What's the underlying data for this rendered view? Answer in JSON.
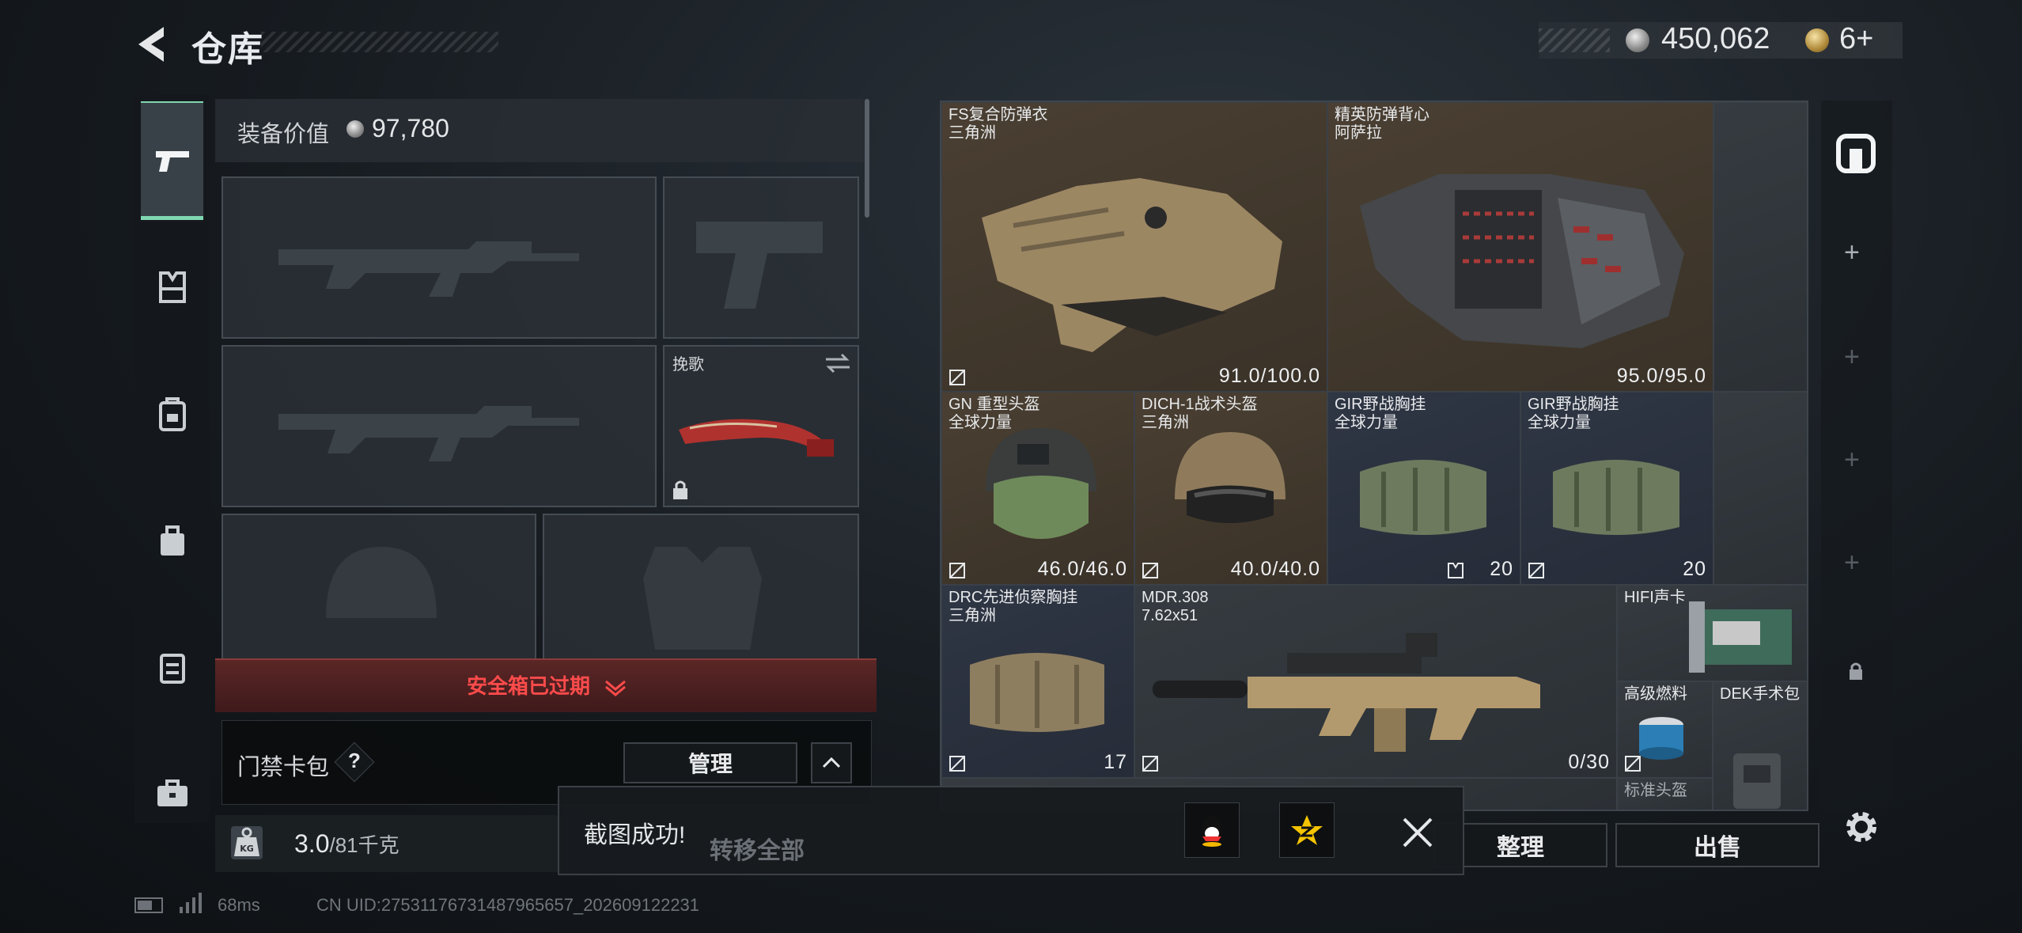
{
  "header": {
    "title": "仓库",
    "silver_amount": "450,062",
    "gold_amount": "6+"
  },
  "left_nav": {
    "items": [
      "pistol-icon",
      "chest-rig-icon",
      "backpack-icon",
      "pouch-icon",
      "case-icon",
      "briefcase-icon"
    ],
    "active": 0
  },
  "loadout": {
    "equip_value_label": "装备价值",
    "equip_value": "97,780",
    "melee_name": "挽歌",
    "safe_box_status": "安全箱已过期",
    "keycard_label": "门禁卡包",
    "keycard_help": "?",
    "manage_label": "管理",
    "weight_current": "3.0",
    "weight_max": "/81千克"
  },
  "stash": {
    "items": [
      {
        "name": "FS复合防弹衣",
        "sub": "三角洲",
        "stat": "91.0/100.0"
      },
      {
        "name": "精英防弹背心",
        "sub": "阿萨拉",
        "stat": "95.0/95.0"
      },
      {
        "name": "GN 重型头盔",
        "sub": "全球力量",
        "stat": "46.0/46.0"
      },
      {
        "name": "DICH-1战术头盔",
        "sub": "三角洲",
        "stat": "40.0/40.0"
      },
      {
        "name": "GIR野战胸挂",
        "sub": "全球力量",
        "stat": "20"
      },
      {
        "name": "GIR野战胸挂",
        "sub": "全球力量",
        "stat": "20"
      },
      {
        "name": "DRC先进侦察胸挂",
        "sub": "三角洲",
        "stat": "17"
      },
      {
        "name": "MDR.308",
        "sub": "7.62x51",
        "stat": "0/30"
      },
      {
        "name": "HIFI声卡",
        "sub": "",
        "stat": ""
      },
      {
        "name": "高级燃料",
        "sub": "",
        "stat": ""
      },
      {
        "name": "DEK手术包",
        "sub": "",
        "stat": ""
      },
      {
        "name": "标准头盔",
        "sub": "",
        "stat": ""
      }
    ]
  },
  "actions": {
    "sort_label": "整理",
    "sell_label": "出售",
    "transfer_all_label": "转移全部"
  },
  "toast": {
    "message": "截图成功!"
  },
  "status": {
    "ping": "68ms",
    "uid": "CN UID:2753117673148796565​7_202609122231"
  },
  "colors": {
    "accent_green": "#7fd7b0",
    "danger_red": "#ff4b4b",
    "item_brown": "#4a3f32",
    "item_slate": "#2f3644"
  }
}
